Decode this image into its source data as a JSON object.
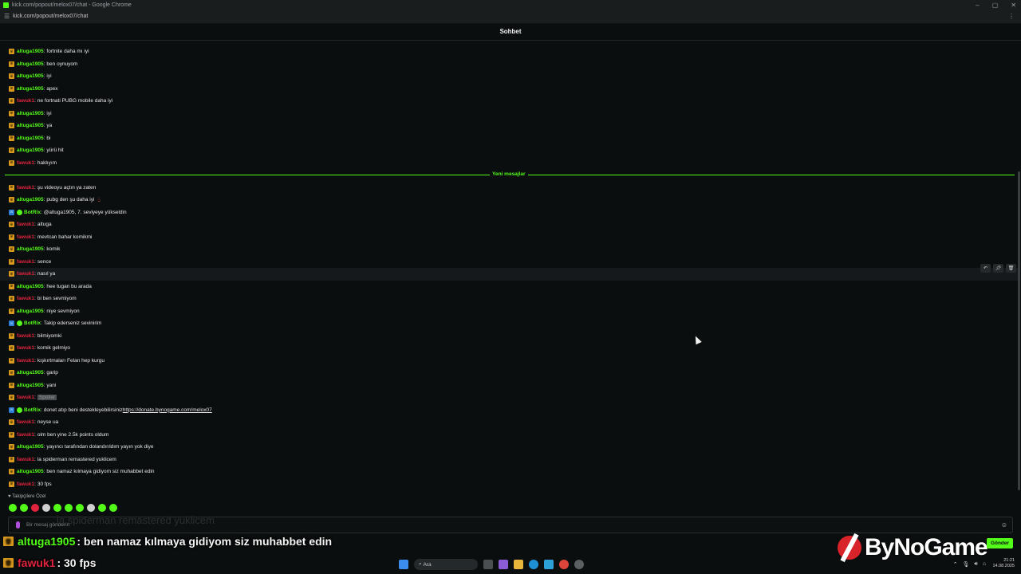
{
  "browser": {
    "window_title": "kick.com/popout/melox07/chat - Google Chrome",
    "url": "kick.com/popout/melox07/chat"
  },
  "chat": {
    "header_title": "Sohbet",
    "divider_label": "Yeni mesajlar",
    "followers_label": "Takipçilere Özel",
    "input_placeholder": "Bir mesaj gönderin",
    "input_ghost_text": "la spiderman remastered yuklicem",
    "send_label": "Gönder",
    "messages_before": [
      {
        "user": "altuga1905",
        "color": "green",
        "text": "fortnite daha mı iyi"
      },
      {
        "user": "altuga1905",
        "color": "green",
        "text": "ben oynuyom"
      },
      {
        "user": "altuga1905",
        "color": "green",
        "text": "iyi"
      },
      {
        "user": "altuga1905",
        "color": "green",
        "text": "apex"
      },
      {
        "user": "fawuk1",
        "color": "red",
        "text": "ne fortnati PUBG mobile daha iyi"
      },
      {
        "user": "altuga1905",
        "color": "green",
        "text": "iyi"
      },
      {
        "user": "altuga1905",
        "color": "green",
        "text": "ya"
      },
      {
        "user": "altuga1905",
        "color": "green",
        "text": "bi"
      },
      {
        "user": "altuga1905",
        "color": "green",
        "text": "yürü hit"
      },
      {
        "user": "fawuk1",
        "color": "red",
        "text": "haklıyım"
      }
    ],
    "messages_after": [
      {
        "user": "fawuk1",
        "color": "red",
        "text": "şu videoyu açtın ya zaten"
      },
      {
        "user": "altuga1905",
        "color": "green",
        "text": "pubg den şu daha iyi",
        "extra": "drop"
      },
      {
        "user": "BotRix",
        "color": "lime",
        "bot": true,
        "text": "@altuga1905, 7. seviyeye yükseldin"
      },
      {
        "user": "fawuk1",
        "color": "red",
        "text": "altuga"
      },
      {
        "user": "fawuk1",
        "color": "red",
        "text": "mevtcan bahar komikmi"
      },
      {
        "user": "altuga1905",
        "color": "green",
        "text": "komik"
      },
      {
        "user": "fawuk1",
        "color": "red",
        "text": "sence"
      },
      {
        "user": "fawuk1",
        "color": "red",
        "text": "nasıl ya",
        "highlight": true
      },
      {
        "user": "altuga1905",
        "color": "green",
        "text": "hee tugan bu arada"
      },
      {
        "user": "fawuk1",
        "color": "red",
        "text": "bi ben sevmiyom"
      },
      {
        "user": "altuga1905",
        "color": "green",
        "text": "niye sevmiyon"
      },
      {
        "user": "BotRix",
        "color": "lime",
        "bot": true,
        "text": "Takip ederseniz sevinirim"
      },
      {
        "user": "fawuk1",
        "color": "red",
        "text": "bilmiyomki"
      },
      {
        "user": "fawuk1",
        "color": "red",
        "text": "komik gelmiyo"
      },
      {
        "user": "fawuk1",
        "color": "red",
        "text": "kışkırtmaları Felan hep kurgu"
      },
      {
        "user": "altuga1905",
        "color": "green",
        "text": "garip"
      },
      {
        "user": "altuga1905",
        "color": "green",
        "text": "yani"
      },
      {
        "user": "fawuk1",
        "color": "red",
        "text": "Spoiler",
        "spoiler": true
      },
      {
        "user": "BotRix",
        "color": "lime",
        "bot": true,
        "text": "donet atıp beni destekleyebilirsiniz ",
        "link": "https://donate.bynogame.com/melox07"
      },
      {
        "user": "fawuk1",
        "color": "red",
        "text": "neyse ua"
      },
      {
        "user": "fawuk1",
        "color": "red",
        "text": "olm ben yine 2.5k points oldum"
      },
      {
        "user": "altuga1905",
        "color": "green",
        "text": "yayıncı tarafından dolandırıldım yayın yok diye"
      },
      {
        "user": "fawuk1",
        "color": "red",
        "text": "la spiderman remastered yuklicem"
      },
      {
        "user": "altuga1905",
        "color": "green",
        "text": "ben namaz kılmaya gidiyom siz muhabbet edin"
      },
      {
        "user": "fawuk1",
        "color": "red",
        "text": "30 fps"
      }
    ]
  },
  "overlay": {
    "line1_user": "altuga1905",
    "line1_text": ": ben namaz kılmaya gidiyom siz muhabbet edin",
    "line2_user": "fawuk1",
    "line2_text": ": 30 fps",
    "brand": "ByNoGame"
  },
  "taskbar": {
    "search_label": "Ara",
    "time": "21:21",
    "date": "14.08.2025"
  },
  "colors": {
    "accent": "#53fc18",
    "red_user": "#e0243e",
    "background": "#0b0e0f"
  }
}
